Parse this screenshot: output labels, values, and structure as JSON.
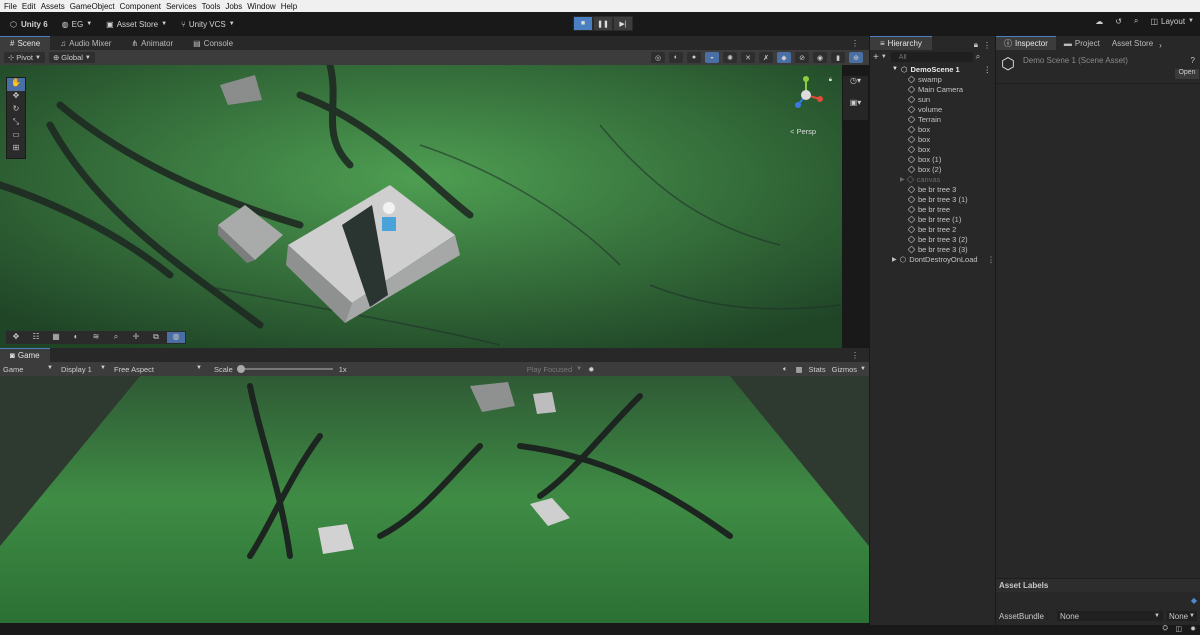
{
  "menu": [
    "File",
    "Edit",
    "Assets",
    "GameObject",
    "Component",
    "Services",
    "Tools",
    "Jobs",
    "Window",
    "Help"
  ],
  "toolbar": {
    "unity": "Unity 6",
    "account": "EG",
    "asset_store": "Asset Store",
    "vcs": "Unity VCS",
    "layout": "Layout"
  },
  "scene_tabs": [
    "Scene",
    "Audio Mixer",
    "Animator",
    "Console"
  ],
  "scene_tools": {
    "pivot": "Pivot",
    "global": "Global"
  },
  "gizmo": {
    "persp": "< Persp"
  },
  "game": {
    "tab": "Game",
    "mode": "Game",
    "display": "Display 1",
    "aspect": "Free Aspect",
    "scale_label": "Scale",
    "scale_value": "1x",
    "play_focused": "Play Focused",
    "stats": "Stats",
    "gizmos": "Gizmos"
  },
  "hierarchy": {
    "tab": "Hierarchy",
    "search_placeholder": "All",
    "scene": "DemoScene 1",
    "items": [
      "swamp",
      "Main Camera",
      "sun",
      "volume",
      "Terrain",
      "box",
      "box",
      "box",
      "box (1)",
      "box (2)",
      "canvas",
      "be br tree 3",
      "be br tree 3 (1)",
      "be br tree",
      "be br tree (1)",
      "be br tree 2",
      "be br tree 3 (2)",
      "be br tree 3 (3)"
    ],
    "dont_destroy": "DontDestroyOnLoad"
  },
  "inspector": {
    "tabs": [
      "Inspector",
      "Project",
      "Asset Store"
    ],
    "title": "Demo Scene 1 (Scene Asset)",
    "open": "Open",
    "asset_labels": "Asset Labels",
    "asset_bundle": "AssetBundle",
    "bundle_value": "None",
    "variant_value": "None"
  }
}
